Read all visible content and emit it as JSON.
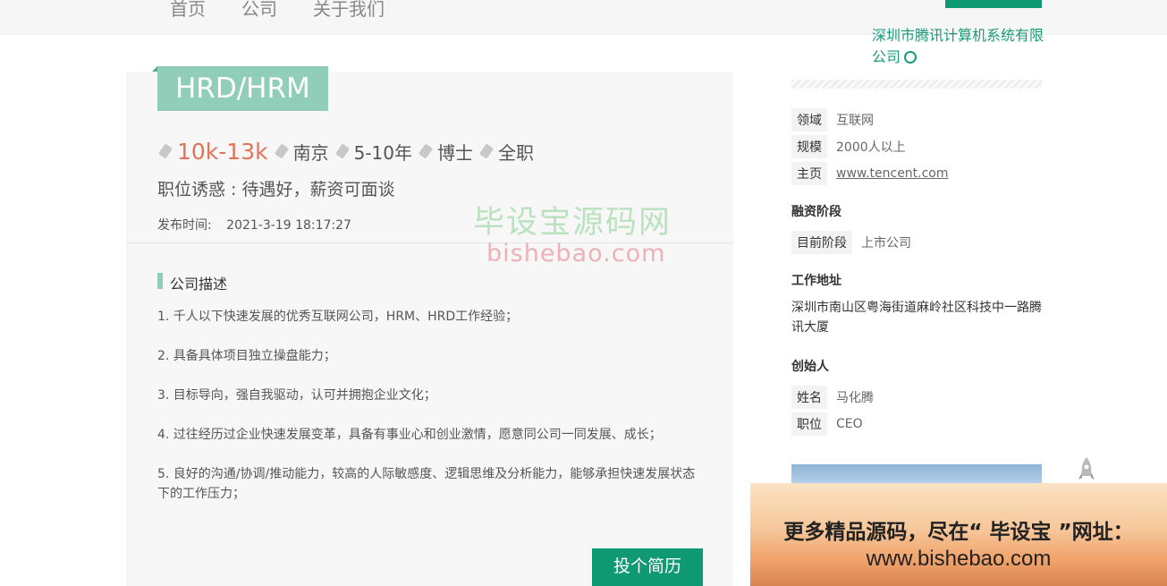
{
  "nav": {
    "items": [
      "首页",
      "公司",
      "关于我们"
    ]
  },
  "job": {
    "title": "HRD/HRM",
    "salary": "10k-13k",
    "city": "南京",
    "experience": "5-10年",
    "education": "博士",
    "type": "全职",
    "advantage": "职位诱惑 : 待遇好，薪资可面谈",
    "publish_label": "发布时间:",
    "publish_time": "2021-3-19 18:17:27",
    "section_title": "公司描述",
    "description": [
      "1. 千人以下快速发展的优秀互联网公司，HRM、HRD工作经验；",
      "2. 具备具体项目独立操盘能力；",
      "3. 目标导向，强自我驱动，认可并拥抱企业文化；",
      "4. 过往经历过企业快速发展变革，具备有事业心和创业激情，愿意同公司一同发展、成长；",
      "5. 良好的沟通/协调/推动能力，较高的人际敏感度、逻辑思维及分析能力，能够承担快速发展状态下的工作压力；"
    ],
    "apply_label": "投个简历"
  },
  "watermark": {
    "cn": "毕设宝源码网",
    "en": "bishebao.com"
  },
  "company": {
    "name": "深圳市腾讯计算机系统有限公司",
    "field_label": "领域",
    "field_value": "互联网",
    "scale_label": "规模",
    "scale_value": "2000人以上",
    "homepage_label": "主页",
    "homepage_value": "www.tencent.com",
    "funding_title": "融资阶段",
    "stage_label": "目前阶段",
    "stage_value": "上市公司",
    "address_title": "工作地址",
    "address": "深圳市南山区粤海街道麻岭社区科技中一路腾讯大厦",
    "founder_title": "创始人",
    "founder_name_label": "姓名",
    "founder_name": "马化腾",
    "founder_position_label": "职位",
    "founder_position": "CEO"
  },
  "promo": {
    "line1": "更多精品源码，尽在“ 毕设宝 ”网址：",
    "line2": "www.bishebao.com"
  },
  "colors": {
    "accent": "#0f9a73",
    "tag": "#91ceb9",
    "salary": "#e3735a"
  }
}
